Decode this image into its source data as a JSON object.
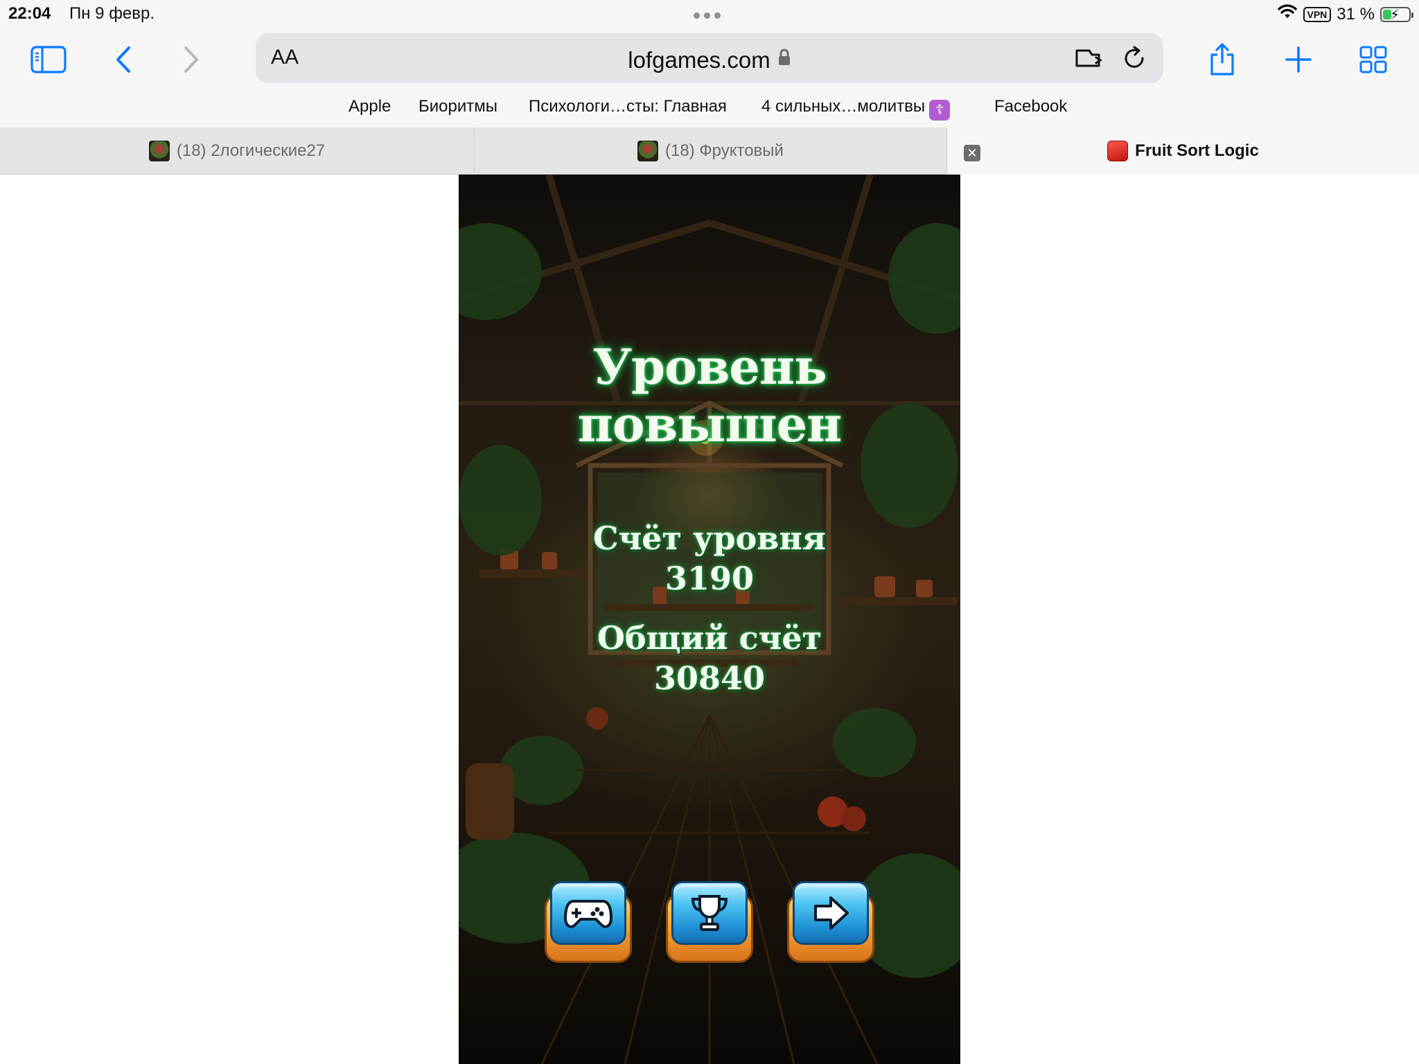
{
  "status_bar": {
    "time": "22:04",
    "date": "Пн 9 февр.",
    "vpn": "VPN",
    "battery": "31 %"
  },
  "toolbar": {
    "aa_label": "AA",
    "url": "lofgames.com"
  },
  "favorites": [
    "Apple",
    "Биоритмы",
    "Психологи…сты: Главная",
    "4 сильных…молитвы",
    "Facebook"
  ],
  "tabs": [
    {
      "title": "(18) 2логические27"
    },
    {
      "title": "(18) Фруктовый"
    },
    {
      "title": "Fruit Sort Logic"
    }
  ],
  "game": {
    "title": "Уровень повышен",
    "level_score_label": "Счёт уровня",
    "level_score": "3190",
    "total_score_label": "Общий счёт",
    "total_score": "30840",
    "buttons": [
      {
        "icon": "gamepad-icon"
      },
      {
        "icon": "trophy-icon"
      },
      {
        "icon": "next-arrow-icon"
      }
    ]
  },
  "colors": {
    "accent": "#0a7aff",
    "glow": "#2bd05b",
    "button_face": "#4cc4f2",
    "button_base": "#f7a533"
  }
}
